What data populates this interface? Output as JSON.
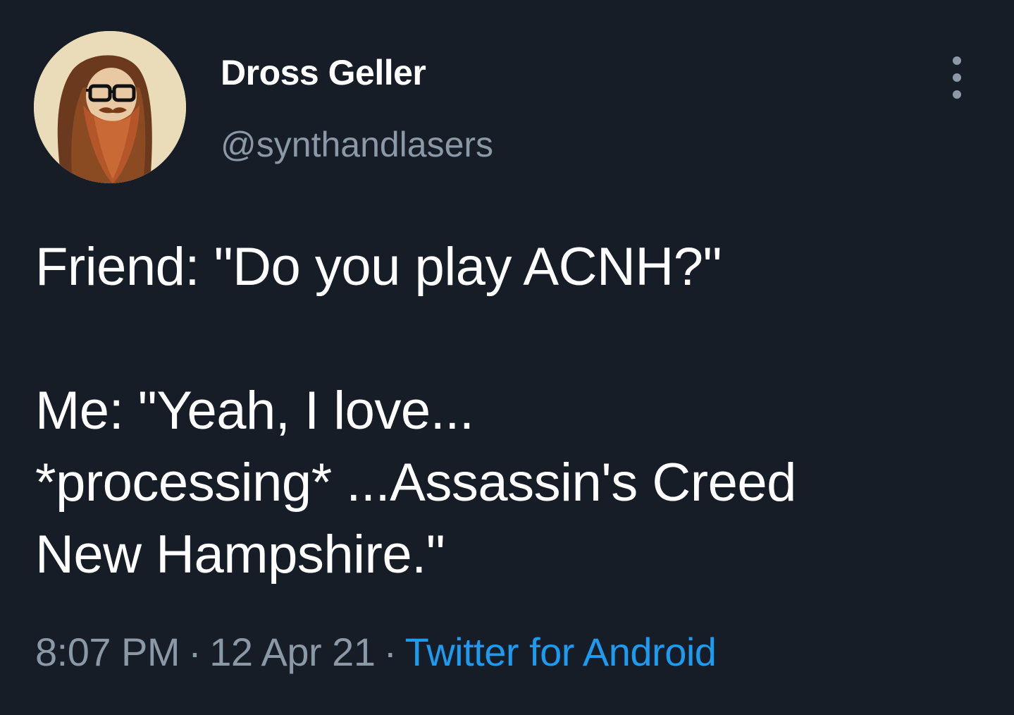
{
  "user": {
    "display_name": "Dross Geller",
    "handle": "@synthandlasers",
    "avatar_icon": "bearded-man-with-glasses-avatar"
  },
  "tweet": {
    "line1": "Friend: \"Do you play ACNH?\"",
    "line2": "Me: \"Yeah, I love...",
    "line3": "*processing* ...Assassin's Creed",
    "line4": "New Hampshire.\""
  },
  "meta": {
    "time": "8:07 PM",
    "separator": "·",
    "date": "12 Apr 21",
    "source": "Twitter for Android"
  },
  "colors": {
    "background": "#161d27",
    "text": "#ffffff",
    "secondary": "#8b98a5",
    "link": "#1d9bf0"
  },
  "icons": {
    "more": "more-vertical-icon"
  }
}
